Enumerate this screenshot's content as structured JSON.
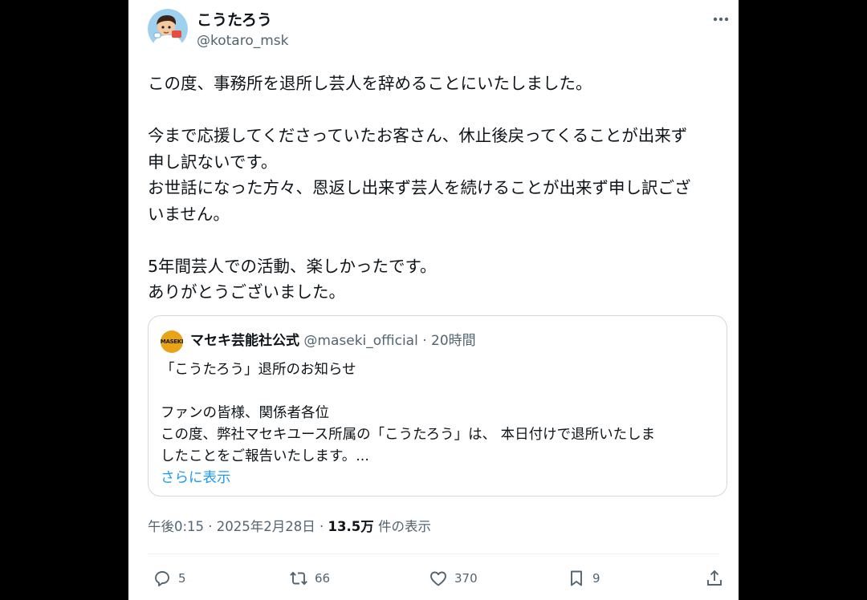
{
  "tweet": {
    "author": {
      "display_name": "こうたろう",
      "handle": "@kotaro_msk"
    },
    "paragraphs": [
      "この度、事務所を退所し芸人を辞めることにいたしました。",
      "",
      "今まで応援してくださっていたお客さん、休止後戻ってくることが出来ず",
      "申し訳ないです。",
      "お世話になった方々、恩返し出来ず芸人を続けることが出来ず申し訳ござ",
      "いません。",
      "",
      "5年間芸人での活動、楽しかったです。",
      "ありがとうございました。"
    ],
    "timestamp": "午後0:15 · 2025年2月28日 · ",
    "views_count": "13.5万",
    "views_suffix": " 件の表示",
    "replies": "5",
    "reposts": "66",
    "likes": "370",
    "bookmarks": "9"
  },
  "quote": {
    "logo_text": "MASEKI",
    "display_name": "マセキ芸能社公式",
    "meta": " @maseki_official · 20時間",
    "lines": [
      "「こうたろう」退所のお知らせ",
      "",
      "ファンの皆様、関係者各位",
      "この度、弊社マセキユース所属の「こうたろう」は、 本日付けで退所いたしま",
      "したことをご報告いたします。..."
    ],
    "show_more": "さらに表示"
  },
  "icons": {
    "more": "more-horizontal-icon",
    "reply": "reply-icon",
    "repost": "repost-icon",
    "like": "heart-icon",
    "bookmark": "bookmark-icon",
    "share": "share-icon"
  },
  "colors": {
    "accent": "#1d9bf0",
    "secondary_text": "#536471",
    "maseki_logo": "#e8a317"
  }
}
